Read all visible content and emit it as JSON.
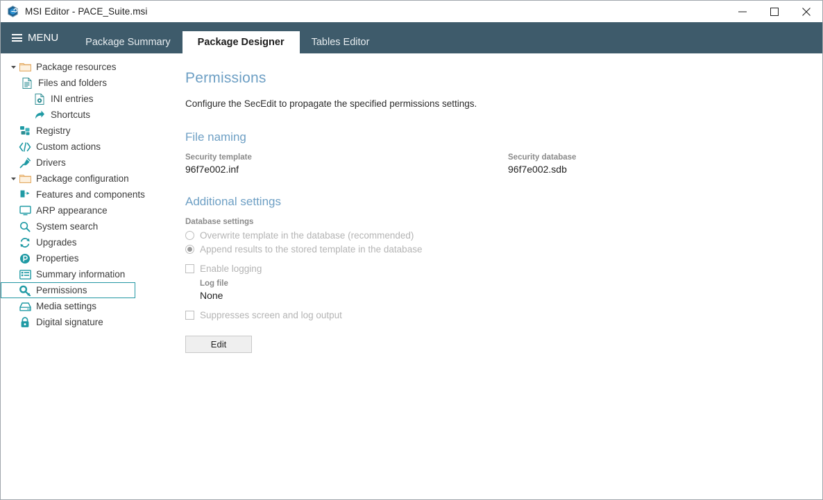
{
  "window": {
    "title": "MSI Editor - PACE_Suite.msi",
    "app_icon": "app-hexagon-icon",
    "controls": [
      {
        "name": "minimize",
        "glyph": "minimize-icon"
      },
      {
        "name": "maximize",
        "glyph": "maximize-icon"
      },
      {
        "name": "close",
        "glyph": "close-icon"
      }
    ]
  },
  "menubar": {
    "menu_label": "MENU",
    "menu_icon": "hamburger-icon",
    "tabs": [
      {
        "label": "Package Summary",
        "active": false
      },
      {
        "label": "Package Designer",
        "active": true
      },
      {
        "label": "Tables Editor",
        "active": false
      }
    ]
  },
  "sidebar": {
    "items": [
      {
        "label": "Package resources",
        "icon": "folder-icon",
        "level": 0,
        "arrow": "expanded",
        "selected": false
      },
      {
        "label": "Files and folders",
        "icon": "file-icon",
        "level": 1,
        "arrow": "none",
        "selected": false
      },
      {
        "label": "INI entries",
        "icon": "ini-file-icon",
        "level": 2,
        "arrow": "none",
        "selected": false
      },
      {
        "label": "Shortcuts",
        "icon": "shortcut-icon",
        "level": 2,
        "arrow": "none",
        "selected": false
      },
      {
        "label": "Registry",
        "icon": "registry-icon",
        "level": 1,
        "arrow": "none",
        "selected": false
      },
      {
        "label": "Custom actions",
        "icon": "code-icon",
        "level": 1,
        "arrow": "none",
        "selected": false
      },
      {
        "label": "Drivers",
        "icon": "plug-icon",
        "level": 1,
        "arrow": "none",
        "selected": false
      },
      {
        "label": "Package configuration",
        "icon": "folder-icon",
        "level": 0,
        "arrow": "expanded",
        "selected": false
      },
      {
        "label": "Features and components",
        "icon": "puzzle-icon",
        "level": 1,
        "arrow": "none",
        "selected": false
      },
      {
        "label": "ARP appearance",
        "icon": "monitor-icon",
        "level": 1,
        "arrow": "none",
        "selected": false
      },
      {
        "label": "System search",
        "icon": "search-icon",
        "level": 1,
        "arrow": "none",
        "selected": false
      },
      {
        "label": "Upgrades",
        "icon": "refresh-icon",
        "level": 1,
        "arrow": "none",
        "selected": false
      },
      {
        "label": "Properties",
        "icon": "property-icon",
        "level": 1,
        "arrow": "none",
        "selected": false
      },
      {
        "label": "Summary information",
        "icon": "list-icon",
        "level": 1,
        "arrow": "none",
        "selected": false
      },
      {
        "label": "Permissions",
        "icon": "key-icon",
        "level": 1,
        "arrow": "none",
        "selected": true
      },
      {
        "label": "Media settings",
        "icon": "media-icon",
        "level": 1,
        "arrow": "none",
        "selected": false
      },
      {
        "label": "Digital signature",
        "icon": "lock-icon",
        "level": 1,
        "arrow": "none",
        "selected": false
      }
    ]
  },
  "content": {
    "title": "Permissions",
    "description": "Configure the SecEdit to propagate the specified permissions settings.",
    "file_naming": {
      "section_title": "File naming",
      "security_template_label": "Security template",
      "security_template_value": "96f7e002.inf",
      "security_database_label": "Security database",
      "security_database_value": "96f7e002.sdb"
    },
    "additional_settings": {
      "section_title": "Additional settings",
      "database_settings_label": "Database settings",
      "radios": [
        {
          "label": "Overwrite template in the database (recommended)",
          "checked": false
        },
        {
          "label": "Append results to the stored template in the database",
          "checked": true
        }
      ],
      "enable_logging": {
        "label": "Enable logging",
        "checked": false
      },
      "log_file_label": "Log file",
      "log_file_value": "None",
      "suppress": {
        "label": "Suppresses screen and log output",
        "checked": false
      },
      "edit_button": "Edit"
    }
  },
  "colors": {
    "header_bar": "#3e5b6b",
    "accent_teal": "#1e97a3",
    "heading_blue": "#6d9fc4",
    "folder_orange": "#e8b878"
  }
}
